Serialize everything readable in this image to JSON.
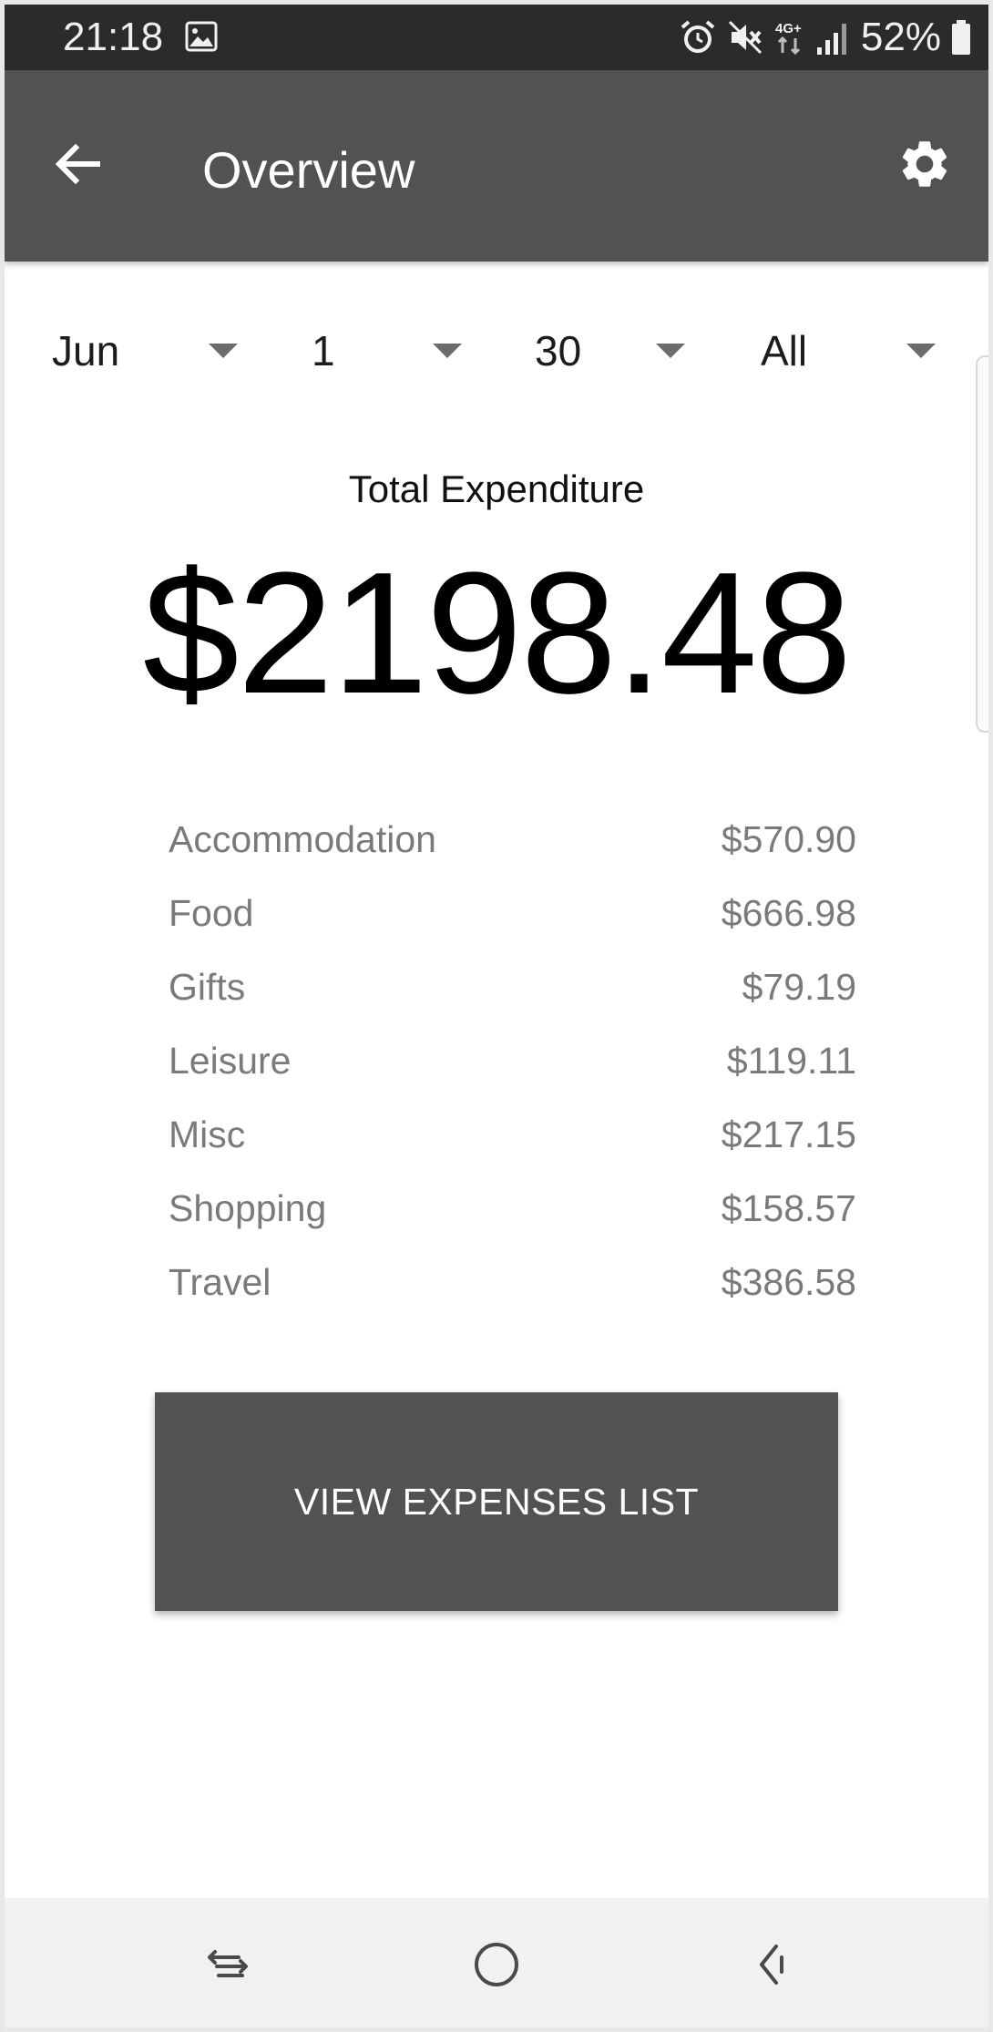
{
  "status_bar": {
    "time": "21:18",
    "battery_percent": "52%",
    "icons": [
      "gallery-icon",
      "alarm-icon",
      "mute-icon",
      "4g-icon",
      "signal-icon",
      "battery-icon"
    ]
  },
  "app_bar": {
    "title": "Overview",
    "back_icon": "arrow-back-icon",
    "settings_icon": "gear-icon"
  },
  "filters": {
    "month": "Jun",
    "start_day": "1",
    "end_day": "30",
    "category": "All"
  },
  "total": {
    "label": "Total Expenditure",
    "amount": "$2198.48"
  },
  "categories": [
    {
      "name": "Accommodation",
      "amount": "$570.90"
    },
    {
      "name": "Food",
      "amount": "$666.98"
    },
    {
      "name": "Gifts",
      "amount": "$79.19"
    },
    {
      "name": "Leisure",
      "amount": "$119.11"
    },
    {
      "name": "Misc",
      "amount": "$217.15"
    },
    {
      "name": "Shopping",
      "amount": "$158.57"
    },
    {
      "name": "Travel",
      "amount": "$386.58"
    }
  ],
  "actions": {
    "view_expenses_label": "VIEW EXPENSES LIST"
  },
  "nav_bar": {
    "icons": [
      "recent-apps-icon",
      "home-icon",
      "back-icon"
    ]
  },
  "colors": {
    "app_bar": "#525252",
    "status_bar": "#2b2b2b",
    "button": "#525252",
    "category_text": "#7a7a7a"
  }
}
